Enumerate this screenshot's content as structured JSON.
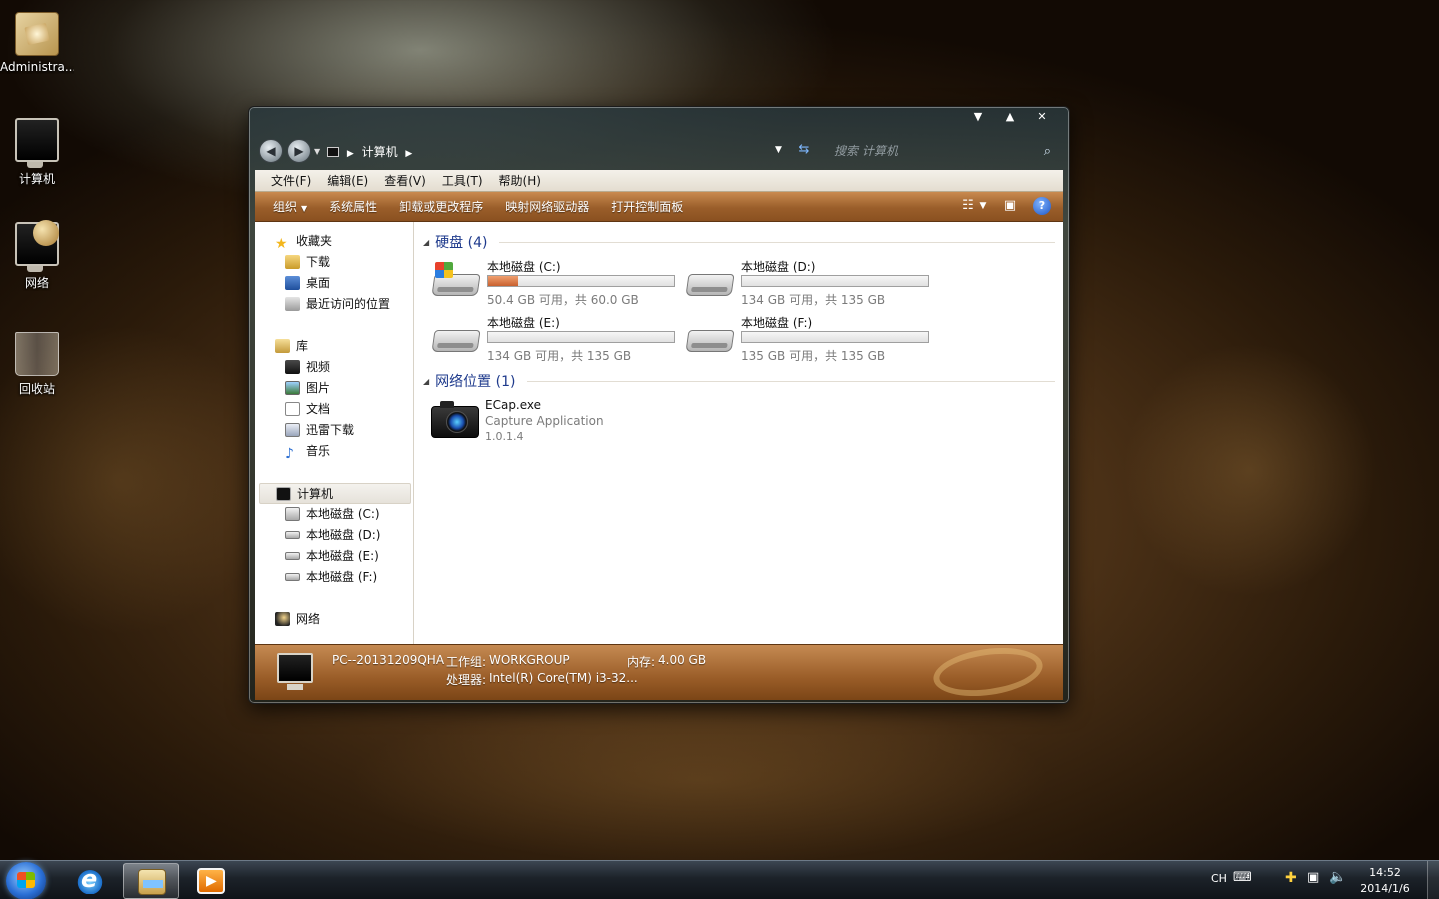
{
  "desktop": {
    "icons": [
      {
        "label": "Administra..."
      },
      {
        "label": "计算机"
      },
      {
        "label": "网络"
      },
      {
        "label": "回收站"
      }
    ]
  },
  "window": {
    "breadcrumb": [
      "计算机"
    ],
    "search_placeholder": "搜索 计算机",
    "menu": [
      "文件(F)",
      "编辑(E)",
      "查看(V)",
      "工具(T)",
      "帮助(H)"
    ],
    "toolbar": {
      "organize": "组织",
      "items": [
        "系统属性",
        "卸载或更改程序",
        "映射网络驱动器",
        "打开控制面板"
      ]
    },
    "sidebar": {
      "favorites": {
        "label": "收藏夹",
        "items": [
          "下载",
          "桌面",
          "最近访问的位置"
        ]
      },
      "libraries": {
        "label": "库",
        "items": [
          "视频",
          "图片",
          "文档",
          "迅雷下载",
          "音乐"
        ]
      },
      "computer": {
        "label": "计算机",
        "items": [
          "本地磁盘 (C:)",
          "本地磁盘 (D:)",
          "本地磁盘 (E:)",
          "本地磁盘 (F:)"
        ]
      },
      "network": {
        "label": "网络"
      }
    },
    "sections": {
      "drives_header": "硬盘 (4)",
      "network_header": "网络位置 (1)"
    },
    "drives": [
      {
        "name": "本地磁盘 (C:)",
        "space": "50.4 GB 可用，共 60.0 GB",
        "used_fraction": 0.16
      },
      {
        "name": "本地磁盘 (D:)",
        "space": "134 GB 可用，共 135 GB",
        "used_fraction": 0.0
      },
      {
        "name": "本地磁盘 (E:)",
        "space": "134 GB 可用，共 135 GB",
        "used_fraction": 0.0
      },
      {
        "name": "本地磁盘 (F:)",
        "space": "135 GB 可用，共 135 GB",
        "used_fraction": 0.0
      }
    ],
    "network_item": {
      "name": "ECap.exe",
      "desc": "Capture Application",
      "version": "1.0.1.4"
    },
    "details": {
      "pc_name": "PC--20131209QHA",
      "workgroup_label": "工作组:",
      "workgroup": "WORKGROUP",
      "memory_label": "内存:",
      "memory": "4.00 GB",
      "cpu_label": "处理器:",
      "cpu": "Intel(R) Core(TM) i3-32..."
    }
  },
  "taskbar": {
    "lang": "CH",
    "time": "14:52",
    "date": "2014/1/6"
  }
}
